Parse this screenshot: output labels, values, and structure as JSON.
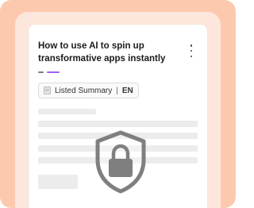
{
  "article": {
    "title": "How to use AI to spin up transformative apps instantly",
    "more_icon": "more-vertical-icon"
  },
  "summary_chip": {
    "icon": "document-icon",
    "label": "Listed Summary",
    "separator": "|",
    "language": "EN"
  },
  "overlay": {
    "icon": "shield-lock-icon"
  },
  "colors": {
    "background": "#fdc9ae",
    "device": "#fde7dc",
    "accent_purple": "#9b62ee",
    "placeholder": "#ececec"
  }
}
